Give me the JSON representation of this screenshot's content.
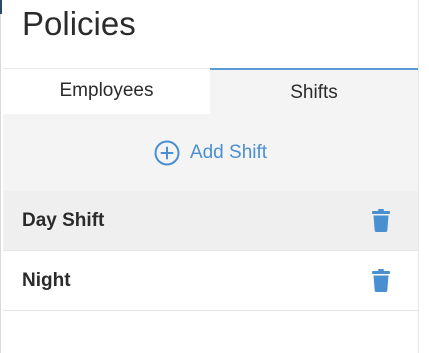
{
  "page": {
    "title": "Policies"
  },
  "tabs": [
    {
      "label": "Employees",
      "active": false
    },
    {
      "label": "Shifts",
      "active": true
    }
  ],
  "actions": {
    "add_shift_label": "Add Shift",
    "add_icon": "plus-circle-icon"
  },
  "shifts": [
    {
      "label": "Day Shift",
      "action_icon": "trash-icon"
    },
    {
      "label": "Night",
      "action_icon": "trash-icon"
    }
  ],
  "colors": {
    "accent": "#4a8fd0",
    "tab_active_border": "#5b9bd5",
    "panel_bg": "#f4f4f4",
    "selected_row_bg": "#efefef"
  }
}
